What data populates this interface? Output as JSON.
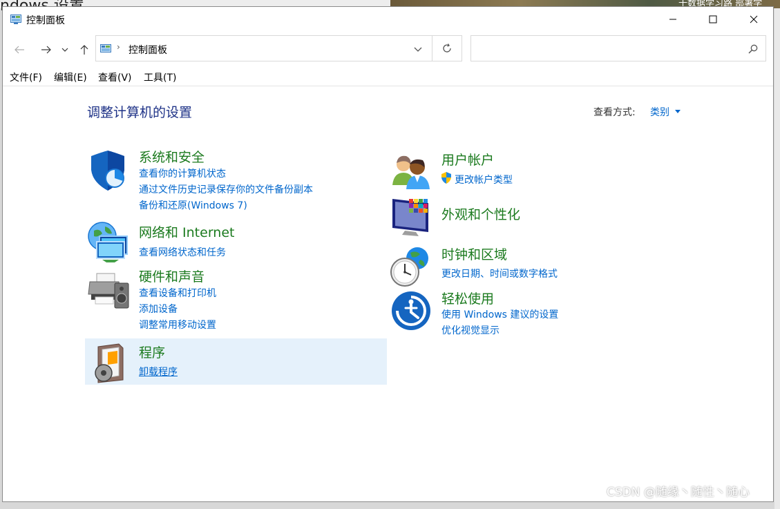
{
  "background": {
    "left_text": "ndows 设置",
    "right_text": "十数据学习路  部署学"
  },
  "window": {
    "title": "控制面板",
    "controls": [
      "minimize",
      "maximize",
      "close"
    ]
  },
  "navigation": {
    "address": "控制面板",
    "search_placeholder": ""
  },
  "menu": [
    {
      "label": "文件(F)"
    },
    {
      "label": "编辑(E)"
    },
    {
      "label": "查看(V)"
    },
    {
      "label": "工具(T)"
    }
  ],
  "main": {
    "heading": "调整计算机的设置",
    "view_by_label": "查看方式:",
    "view_by_value": "类别"
  },
  "categories": {
    "system_security": {
      "title": "系统和安全",
      "links": [
        "查看你的计算机状态",
        "通过文件历史记录保存你的文件备份副本",
        "备份和还原(Windows 7)"
      ]
    },
    "network": {
      "title": "网络和 Internet",
      "links": [
        "查看网络状态和任务"
      ]
    },
    "hardware": {
      "title": "硬件和声音",
      "links": [
        "查看设备和打印机",
        "添加设备",
        "调整常用移动设置"
      ]
    },
    "programs": {
      "title": "程序",
      "links": [
        "卸载程序"
      ]
    },
    "user_accounts": {
      "title": "用户帐户",
      "links": [
        "更改帐户类型"
      ]
    },
    "appearance": {
      "title": "外观和个性化",
      "links": []
    },
    "clock_region": {
      "title": "时钟和区域",
      "links": [
        "更改日期、时间或数字格式"
      ]
    },
    "ease": {
      "title": "轻松使用",
      "links": [
        "使用 Windows 建议的设置",
        "优化视觉显示"
      ]
    }
  },
  "watermark": "CSDN @随缘丶随性丶随心",
  "colors": {
    "heading": "#1e3287",
    "category_title": "#1b7a1e",
    "link": "#0066cc",
    "hover_background": "#e5f1fb"
  }
}
